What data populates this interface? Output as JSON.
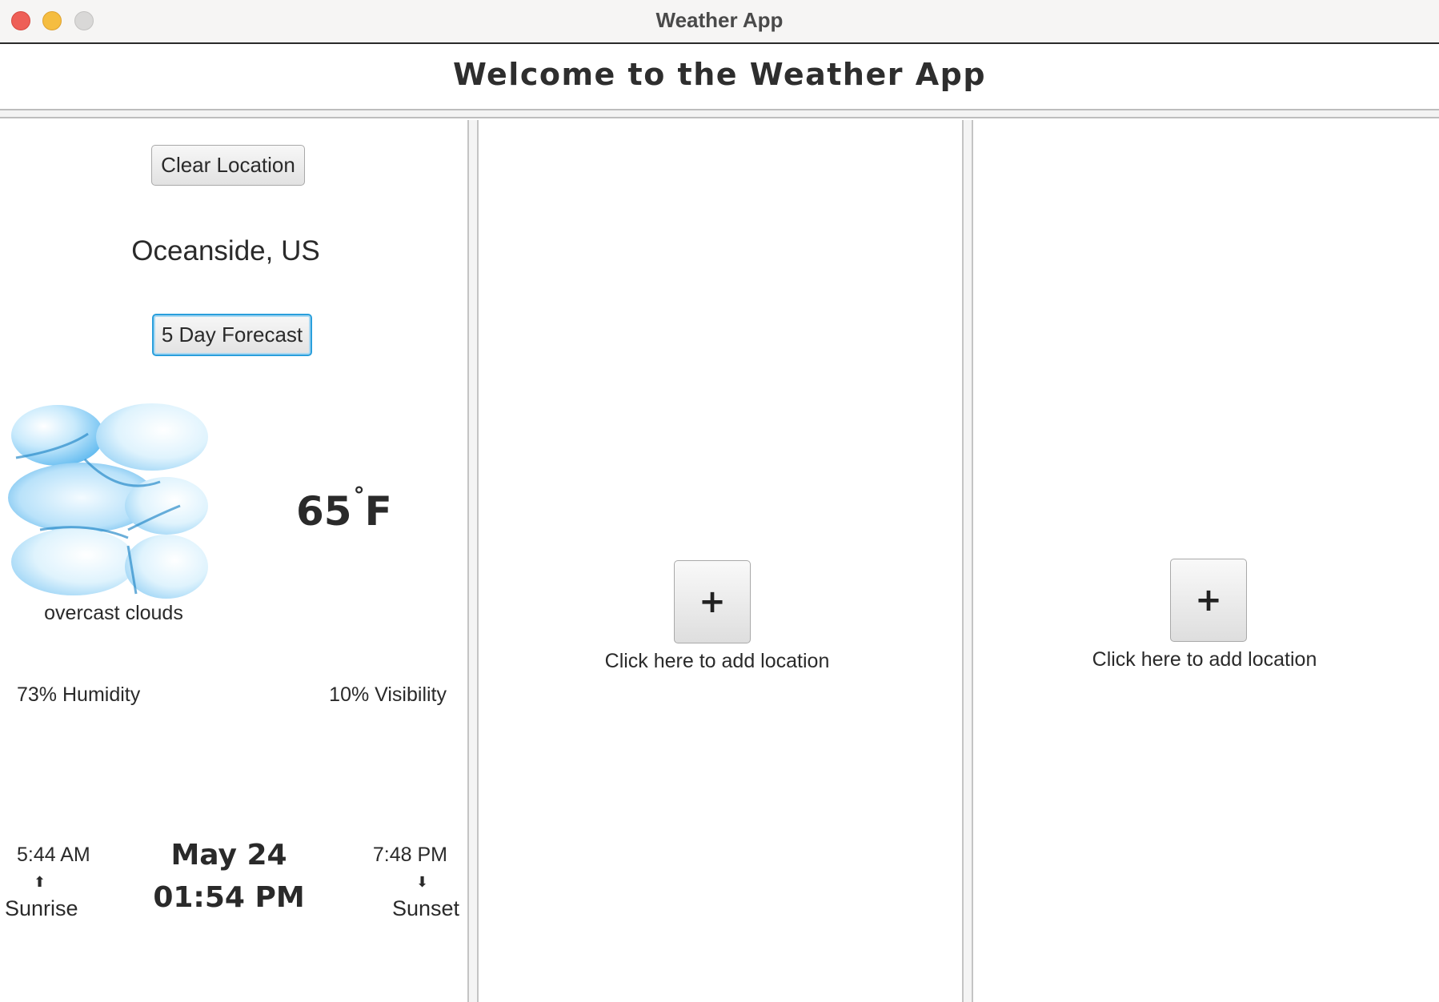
{
  "window": {
    "title": "Weather App"
  },
  "header": {
    "title": "Welcome to the Weather App"
  },
  "location_panel": {
    "clear_button_label": "Clear Location",
    "location_name": "Oceanside, US",
    "forecast_button_label": "5 Day Forecast",
    "weather_icon": "overcast-clouds-icon",
    "weather_description": "overcast clouds",
    "temperature_value": "65",
    "temperature_degree": "°",
    "temperature_unit": "F",
    "humidity": "73% Humidity",
    "visibility": "10% Visibility",
    "sunrise_time": "5:44 AM",
    "sunrise_arrow": "⬆",
    "sunrise_label": "Sunrise",
    "date": "May 24",
    "time": "01:54 PM",
    "sunset_time": "7:48 PM",
    "sunset_arrow": "⬇",
    "sunset_label": "Sunset"
  },
  "empty_slots": [
    {
      "button_label": "+",
      "hint": "Click here to add location"
    },
    {
      "button_label": "+",
      "hint": "Click here to add location"
    }
  ],
  "colors": {
    "focus_ring": "#2a9fdc",
    "close": "#ee5f57",
    "minimize": "#f5bd40",
    "zoom": "#d9d8d7"
  }
}
